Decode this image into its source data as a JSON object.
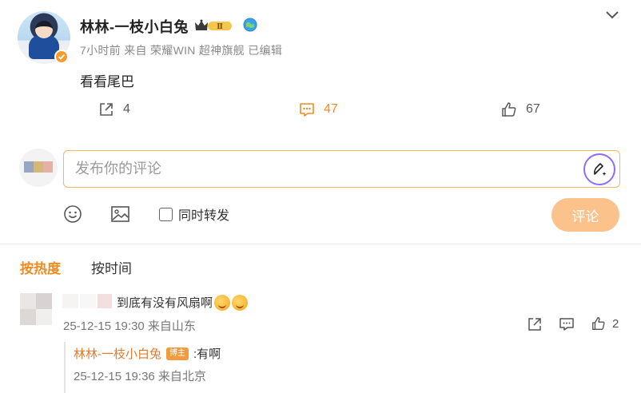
{
  "post": {
    "username": "林林-一枝小白兔",
    "level_badge": "Ⅱ",
    "meta": "7小时前 来自 荣耀WIN 超神旗舰 已编辑",
    "text": "看看尾巴",
    "share_count": "4",
    "comment_count": "47",
    "like_count": "67"
  },
  "composer": {
    "placeholder": "发布你的评论",
    "repost_label": "同时转发",
    "submit_label": "评论"
  },
  "sort": {
    "hot_label": "按热度",
    "time_label": "按时间"
  },
  "comments": [
    {
      "text": "到底有没有风扇啊",
      "meta": "25-12-15 19:30 来自山东",
      "like_count": "2",
      "reply": {
        "author": "林林-一枝小白兔",
        "badge": "博主",
        "text": ":有啊",
        "meta": "25-12-15 19:36 来自北京"
      }
    }
  ],
  "colors": {
    "accent_orange": "#f18b20",
    "submit_disabled": "#fbc28c",
    "input_border": "#f3b863",
    "pen_ring": "#8f6cff"
  },
  "icons": {
    "share": "share-icon",
    "comment": "comment-icon",
    "like": "thumbs-up-icon",
    "emoji": "emoji-icon",
    "image": "image-icon",
    "more": "chevron-down-icon",
    "pen": "ai-pen-icon"
  }
}
